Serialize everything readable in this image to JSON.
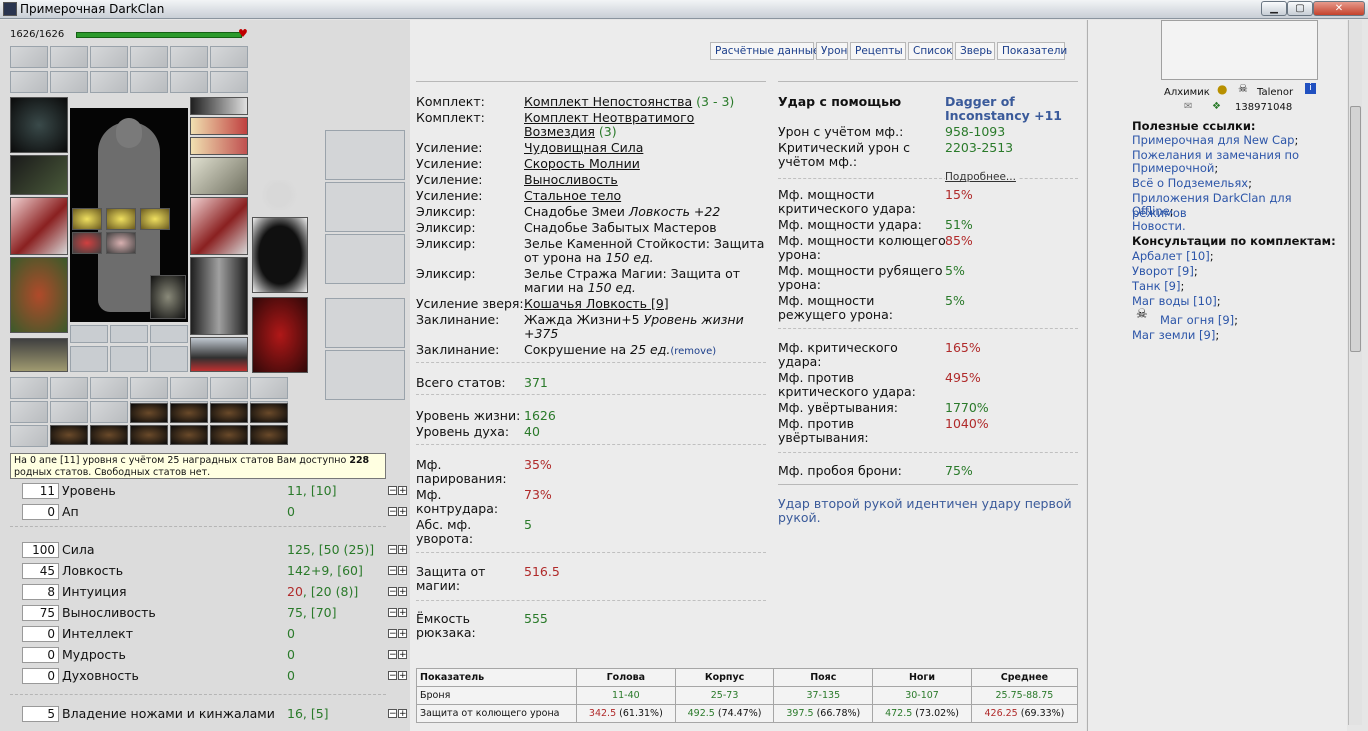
{
  "window": {
    "title": "Примерочная DarkClan",
    "min": "▁",
    "max": "▢",
    "close": "✕"
  },
  "hp": {
    "text": "1626/1626",
    "fraction": 1.0
  },
  "tabs": [
    "Расчётные данные",
    "Урон",
    "Рецепты",
    "Список",
    "Зверь",
    "Показатели"
  ],
  "tooltip": {
    "pre": "На 0 апе [11] уровня с учётом 25 наградных статов Вам доступно ",
    "bold": "228",
    "post": " родных статов. Свободных статов нет."
  },
  "stats": {
    "level": {
      "input": "11",
      "label": "Уровень",
      "value": "11, [10]"
    },
    "ap": {
      "input": "0",
      "label": "Ап",
      "value": "0"
    },
    "strength": {
      "input": "100",
      "label": "Сила",
      "value": "125, [50 (25)]"
    },
    "agility": {
      "input": "45",
      "label": "Ловкость",
      "value": "142+9, [60]"
    },
    "intuition": {
      "input": "8",
      "label": "Интуиция",
      "value_red": "20",
      "value": ", [20 (8)]"
    },
    "endurance": {
      "input": "75",
      "label": "Выносливость",
      "value": "75, [70]"
    },
    "intellect": {
      "input": "0",
      "label": "Интеллект",
      "value": "0"
    },
    "wisdom": {
      "input": "0",
      "label": "Мудрость",
      "value": "0"
    },
    "spirit": {
      "input": "0",
      "label": "Духовность",
      "value": "0"
    },
    "knives": {
      "input": "5",
      "label": "Владение ножами и кинжалами",
      "value": "16, [5]"
    }
  },
  "details": {
    "set1": {
      "k": "Комплект:",
      "v": "Комплект Непостоянства",
      "extra": " (3 - 3)"
    },
    "set2": {
      "k": "Комплект:",
      "v1": "Комплект Неотвратимого",
      "v2": "Возмездия",
      "extra": " (3)"
    },
    "boost1": {
      "k": "Усиление:",
      "v": "Чудовищная Сила"
    },
    "boost2": {
      "k": "Усиление:",
      "v": "Скорость Молнии"
    },
    "boost3": {
      "k": "Усиление:",
      "v": "Выносливость"
    },
    "boost4": {
      "k": "Усиление:",
      "v": "Стальное тело"
    },
    "elix1": {
      "k": "Эликсир:",
      "v": "Снадобье Змеи ",
      "vi": "Ловкость +22"
    },
    "elix2": {
      "k": "Эликсир:",
      "v": "Снадобье Забытых Мастеров"
    },
    "elix3": {
      "k": "Эликсир:",
      "v1": "Зелье Каменной Стойкости: Защита",
      "v2": "от урона на ",
      "vi": "150 ед."
    },
    "elix4": {
      "k": "Эликсир:",
      "v1": "Зелье Стража Магии: Защита от",
      "v2": "магии на ",
      "vi": "150 ед."
    },
    "pet": {
      "k": "Усиление зверя:",
      "v": "Кошачья Ловкость [9]"
    },
    "spell1": {
      "k": "Заклинание:",
      "v1": "Жажда Жизни+5 ",
      "vi1": "Уровень жизни",
      "vi2": "+375"
    },
    "spell2": {
      "k": "Заклинание:",
      "v": "Сокрушение на ",
      "vi": "25 ед.",
      "rm": "(remove)"
    },
    "total": {
      "k": "Всего статов:",
      "v": "371"
    },
    "life": {
      "k": "Уровень жизни:",
      "v": "1626"
    },
    "spirit": {
      "k": "Уровень духа:",
      "v": "40"
    },
    "parry": {
      "k1": "Мф.",
      "k2": "парирования:",
      "v": "35%"
    },
    "counter": {
      "k1": "Мф.",
      "k2": "контрудара:",
      "v": "73%"
    },
    "dodgeabs": {
      "k1": "Абс. мф.",
      "k2": "уворота:",
      "v": "5"
    },
    "magicdef": {
      "k1": "Защита от",
      "k2": "магии:",
      "v": "516.5"
    },
    "backpack": {
      "k1": "Ёмкость",
      "k2": "рюкзака:",
      "v": "555"
    }
  },
  "strike": {
    "title": "Удар с помощью",
    "weapon1": "Dagger of",
    "weapon2": "Inconstancy +11",
    "dmg": {
      "k": "Урон с учётом мф.:",
      "v": "958-1093"
    },
    "crit": {
      "k1": "Критический урон с",
      "k2": "учётом мф.:",
      "v": "2203-2513"
    },
    "more": "Подробнее...",
    "m1": {
      "k1": "Мф. мощности",
      "k2": "критического удара:",
      "v": "15%"
    },
    "m2": {
      "k": "Мф. мощности удара:",
      "v": "51%"
    },
    "m3": {
      "k1": "Мф. мощности колющего",
      "k2": "урона:",
      "v": "85%"
    },
    "m4": {
      "k1": "Мф. мощности рубящего",
      "k2": "урона:",
      "v": "5%"
    },
    "m5": {
      "k1": "Мф. мощности",
      "k2": "режущего урона:",
      "v": "5%"
    },
    "c1": {
      "k1": "Мф. критического",
      "k2": "удара:",
      "v": "165%"
    },
    "c2": {
      "k1": "Мф. против",
      "k2": "критического удара:",
      "v": "495%"
    },
    "c3": {
      "k": "Мф. увёртывания:",
      "v": "1770%"
    },
    "c4": {
      "k1": "Мф. против",
      "k2": "увёртывания:",
      "v": "1040%"
    },
    "c5": {
      "k": "Мф. пробоя брони:",
      "v": "75%"
    },
    "note1": "Удар второй рукой идентичен удару первой",
    "note2": "рукой."
  },
  "table": {
    "headers": [
      "Показатель",
      "Голова",
      "Корпус",
      "Пояс",
      "Ноги",
      "Среднее"
    ],
    "armor": [
      "Броня",
      "11-40",
      "25-73",
      "37-135",
      "30-107",
      "25.75-88.75"
    ],
    "stab": {
      "label": "Защита от колющего урона",
      "cells": [
        [
          "342.5",
          " (61.31%)"
        ],
        [
          "492.5",
          " (74.47%)"
        ],
        [
          "397.5",
          " (66.78%)"
        ],
        [
          "472.5",
          " (73.02%)"
        ],
        [
          "426.25",
          " (69.33%)"
        ]
      ]
    }
  },
  "right": {
    "user1": "Алхимик",
    "user2": "Talenor",
    "id": "138971048",
    "useful": "Полезные ссылки:",
    "links": [
      "Примерочная для New Cap",
      "Пожелания и замечания по",
      "Примерочной",
      "Всё о Подземельях",
      "Приложения DarkClan для режимов",
      "Offline",
      "Новости."
    ],
    "consult": "Консультации по комплектам:",
    "sets": [
      "Арбалет [10]",
      "Уворот [9]",
      "Танк [9]",
      "Маг воды [10]",
      "Маг огня [9]",
      "Маг земли [9]"
    ]
  }
}
